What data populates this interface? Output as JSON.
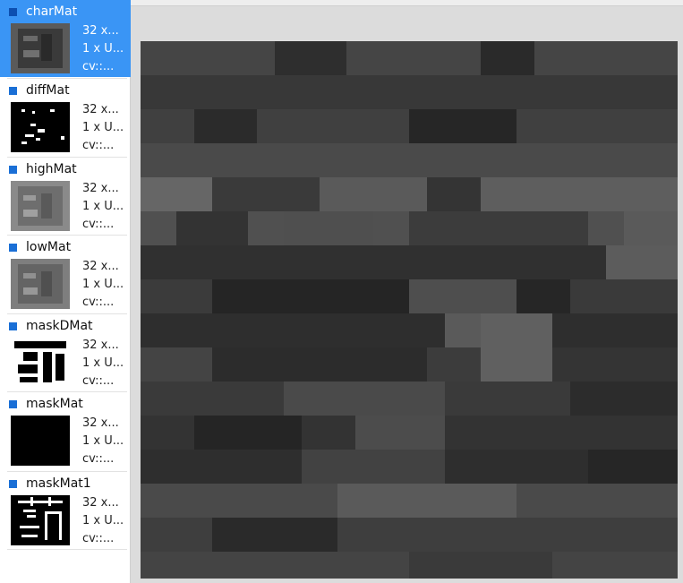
{
  "sidebar": {
    "items": [
      {
        "name": "charMat",
        "l1": "32 x...",
        "l2": "1 x U...",
        "l3": "cv::...",
        "thumb": "gray-char-dark",
        "selected": true
      },
      {
        "name": "diffMat",
        "l1": "32 x...",
        "l2": "1 x U...",
        "l3": "cv::...",
        "thumb": "diff-dots"
      },
      {
        "name": "highMat",
        "l1": "32 x...",
        "l2": "1 x U...",
        "l3": "cv::...",
        "thumb": "gray-char-light"
      },
      {
        "name": "lowMat",
        "l1": "32 x...",
        "l2": "1 x U...",
        "l3": "cv::...",
        "thumb": "gray-char-light"
      },
      {
        "name": "maskDMat",
        "l1": "32 x...",
        "l2": "1 x U...",
        "l3": "cv::...",
        "thumb": "mask-char-white"
      },
      {
        "name": "maskMat",
        "l1": "32 x...",
        "l2": "1 x U...",
        "l3": "cv::...",
        "thumb": "black"
      },
      {
        "name": "maskMat1",
        "l1": "32 x...",
        "l2": "1 x U...",
        "l3": "cv::...",
        "thumb": "mask-char-thin"
      }
    ]
  },
  "colors": {
    "selection": "#3a95f5",
    "marker": "#1a6fd6"
  }
}
